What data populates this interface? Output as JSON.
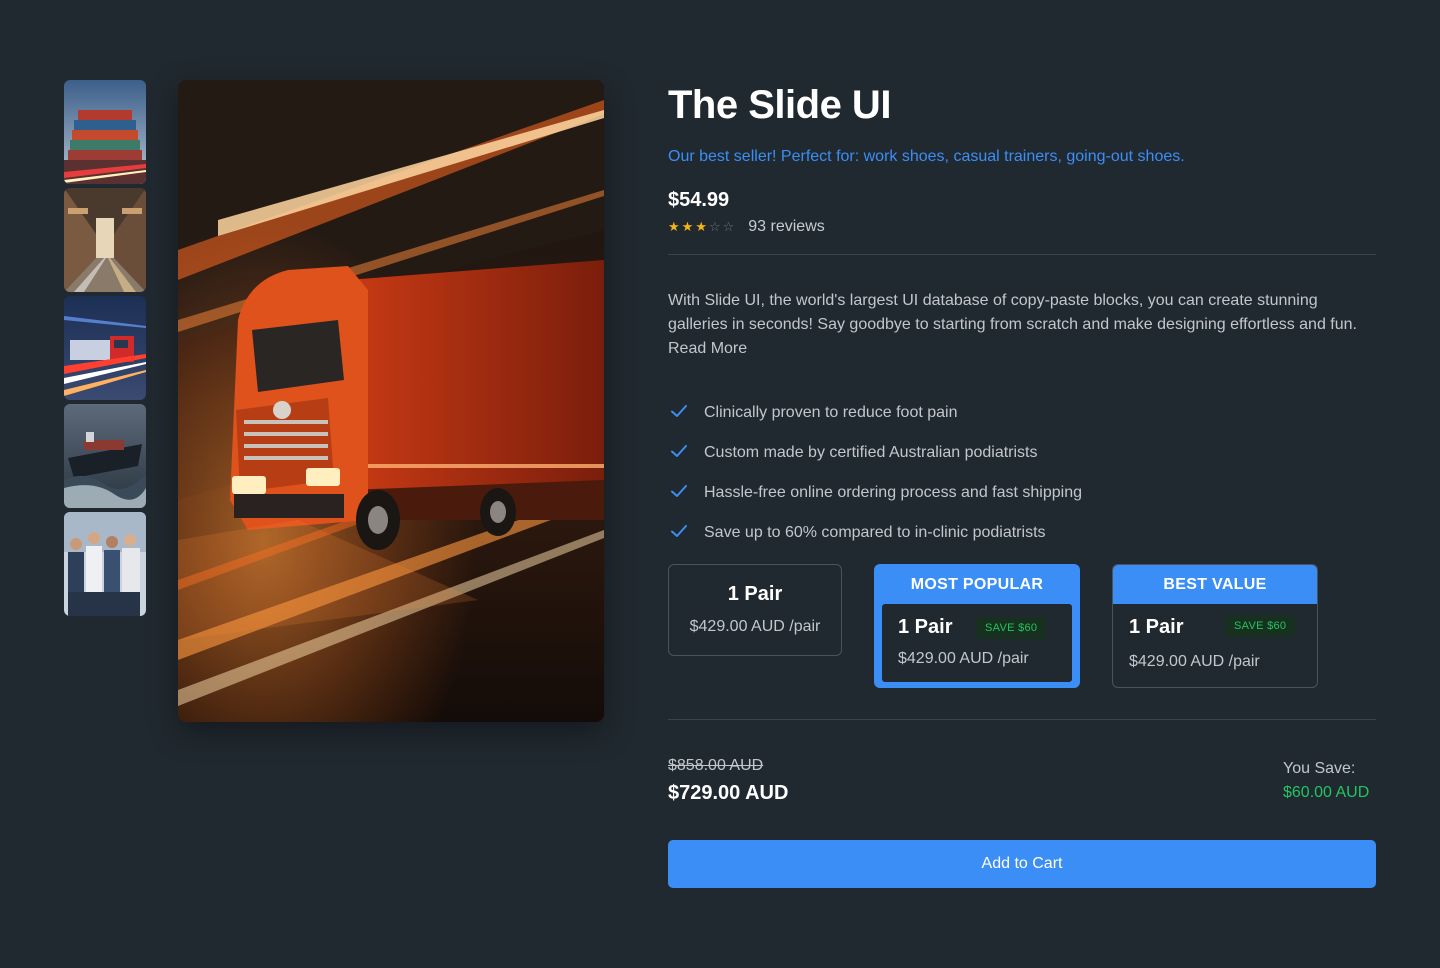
{
  "product": {
    "title": "The Slide UI",
    "tagline": "Our best seller! Perfect for: work shoes, casual trainers, going-out shoes.",
    "price": "$54.99",
    "rating": 3,
    "rating_max": 5,
    "reviews": "93 reviews",
    "description": "With Slide UI, the world's largest UI database of copy-paste blocks, you can create stunning galleries in seconds! Say goodbye to starting from scratch and make designing effortless and fun.",
    "read_more": "Read More"
  },
  "gallery": {
    "thumbnails": [
      {
        "subject": "container-stack"
      },
      {
        "subject": "warehouse-aisle"
      },
      {
        "subject": "truck-light-trails"
      },
      {
        "subject": "cargo-ship"
      },
      {
        "subject": "logistics-team"
      }
    ],
    "main_subject": "red-semi-truck-light-trails"
  },
  "features": [
    "Clinically proven to reduce foot pain",
    "Custom made by certified Australian podiatrists",
    "Hassle-free online ordering process and fast shipping",
    "Save up to 60% compared to in-clinic podiatrists"
  ],
  "packs": [
    {
      "header": "",
      "name": "1 Pair",
      "price": "$429.00 AUD /pair",
      "badge": ""
    },
    {
      "header": "MOST POPULAR",
      "name": "1 Pair",
      "price": "$429.00 AUD /pair",
      "badge": "SAVE $60",
      "selected": true
    },
    {
      "header": "BEST VALUE",
      "name": "1 Pair",
      "price": "$429.00 AUD /pair",
      "badge": "SAVE $60"
    }
  ],
  "totals": {
    "old_price": "$858.00 AUD",
    "new_price": "$729.00 AUD",
    "save_label": "You Save:",
    "save_amount": "$60.00 AUD"
  },
  "cart": {
    "label": "Add to Cart"
  },
  "colors": {
    "background": "#212930",
    "accent": "#3b8ef5",
    "success": "#22c55e",
    "star": "#f5b418"
  }
}
